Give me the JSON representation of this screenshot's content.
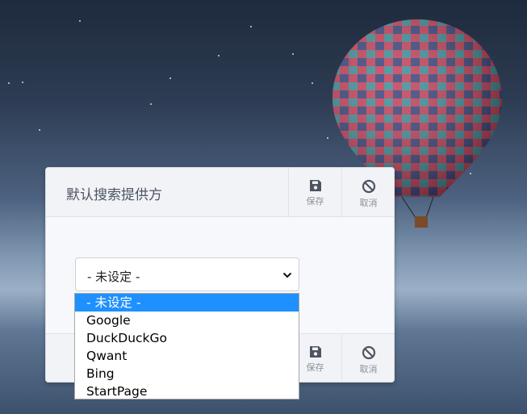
{
  "dialog": {
    "title": "默认搜索提供方",
    "save_label": "保存",
    "cancel_label": "取消",
    "select_value": "- 未设定 -",
    "options": [
      "- 未设定 -",
      "Google",
      "DuckDuckGo",
      "Qwant",
      "Bing",
      "StartPage"
    ],
    "selected_index": 0
  },
  "colors": {
    "highlight": "#1e90ff",
    "icon": "#4e5560"
  },
  "icons": {
    "save": "floppy-disk-icon",
    "cancel": "ban-icon",
    "select_arrow": "chevron-down-icon"
  }
}
